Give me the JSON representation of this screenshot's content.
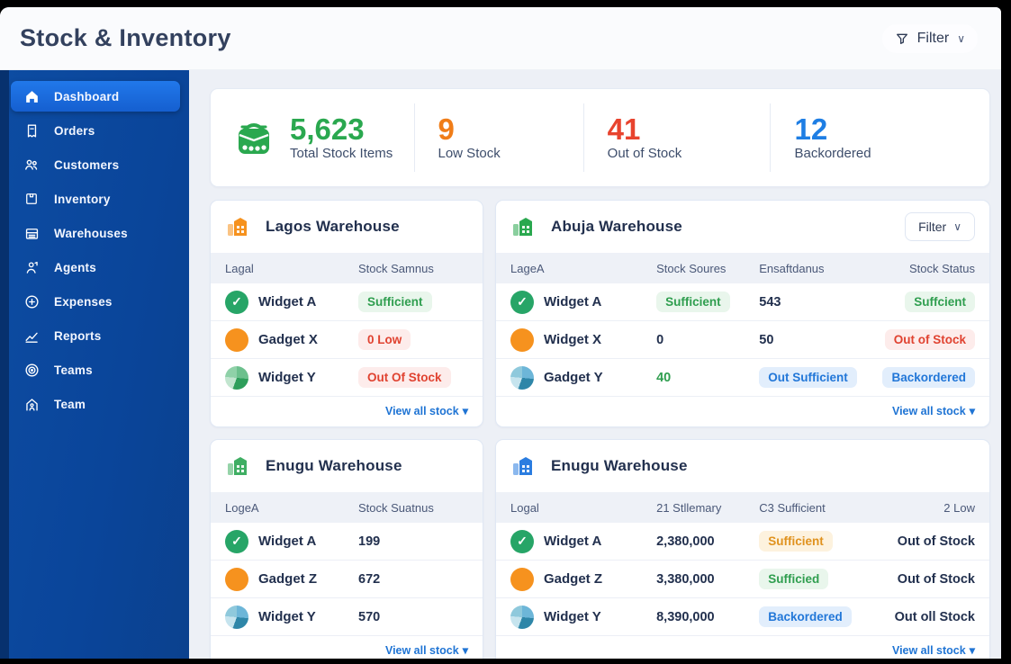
{
  "app": {
    "title": "Stock & Inventory"
  },
  "header": {
    "filter_label": "Filter"
  },
  "colors": {
    "sidebar": "#0a459a",
    "sidebar_active": "#1c6fe0",
    "green": "#2aa84f",
    "orange": "#f07d18",
    "red": "#e8432e",
    "blue": "#1e7ee4",
    "link_blue": "#1f74d4"
  },
  "sidebar": {
    "items": [
      {
        "label": "Dashboard",
        "icon": "home-icon",
        "active": true
      },
      {
        "label": "Orders",
        "icon": "receipt-icon",
        "active": false
      },
      {
        "label": "Customers",
        "icon": "customers-icon",
        "active": false
      },
      {
        "label": "Inventory",
        "icon": "box-icon",
        "active": false
      },
      {
        "label": "Warehouses",
        "icon": "warehouse-icon",
        "active": false
      },
      {
        "label": "Agents",
        "icon": "agent-icon",
        "active": false
      },
      {
        "label": "Expenses",
        "icon": "plus-circle-icon",
        "active": false
      },
      {
        "label": "Reports",
        "icon": "chart-icon",
        "active": false
      },
      {
        "label": "Teams",
        "icon": "target-icon",
        "active": false
      },
      {
        "label": "Team",
        "icon": "house-person-icon",
        "active": false
      }
    ]
  },
  "stats": [
    {
      "value": "5,623",
      "label": "Total Stock Items",
      "color": "#2aa84f",
      "icon": "basket-icon"
    },
    {
      "value": "9",
      "label": "Low Stock",
      "color": "#f07d18",
      "icon": null
    },
    {
      "value": "41",
      "label": "Out of Stock",
      "color": "#e8432e",
      "icon": null
    },
    {
      "value": "12",
      "label": "Backordered",
      "color": "#1e7ee4",
      "icon": null
    }
  ],
  "cards": [
    {
      "title": "Lagos Warehouse",
      "icon": "warehouse-orange-icon",
      "icon_color": "#f6921e",
      "filter_label": null,
      "columns": [
        "Lagal",
        "Stock Samnus"
      ],
      "rows": [
        {
          "icon": "check-circle-icon",
          "name": "Widget A",
          "cells": [
            {
              "text": "Sufficient",
              "style": "badge-green"
            }
          ]
        },
        {
          "icon": "dot-orange-icon",
          "name": "Gadget X",
          "cells": [
            {
              "text": "0 Low",
              "style": "badge-red"
            }
          ]
        },
        {
          "icon": "pie-green-icon",
          "name": "Widget Y",
          "cells": [
            {
              "text": "Out Of Stock",
              "style": "badge-red"
            }
          ]
        }
      ],
      "footer": "View all stock"
    },
    {
      "title": "Abuja Warehouse",
      "icon": "warehouse-green-icon",
      "icon_color": "#2aa84f",
      "filter_label": "Filter",
      "columns": [
        "LageA",
        "Stock Soures",
        "Ensaftdanus",
        "Stock Status"
      ],
      "rows": [
        {
          "icon": "check-circle-icon",
          "name": "Widget A",
          "cells": [
            {
              "text": "Sufficient",
              "style": "badge-green"
            },
            {
              "text": "543",
              "style": "plain"
            },
            {
              "text": "Suffcient",
              "style": "badge-green"
            }
          ]
        },
        {
          "icon": "dot-orange-icon",
          "name": "Widget X",
          "cells": [
            {
              "text": "0",
              "style": "plain"
            },
            {
              "text": "50",
              "style": "plain"
            },
            {
              "text": "Out of Stock",
              "style": "badge-red"
            }
          ]
        },
        {
          "icon": "pie-teal-icon",
          "name": "Gadget Y",
          "cells": [
            {
              "text": "40",
              "style": "text-green"
            },
            {
              "text": "Out Sufficient",
              "style": "badge-blue"
            },
            {
              "text": "Backordered",
              "style": "badge-blue"
            }
          ]
        }
      ],
      "footer": "View all stock"
    },
    {
      "title": "Enugu Warehouse",
      "icon": "warehouse-green-icon",
      "icon_color": "#3fae63",
      "filter_label": null,
      "columns": [
        "LogeA",
        "Stock Suatnus"
      ],
      "rows": [
        {
          "icon": "check-circle-icon",
          "name": "Widget A",
          "cells": [
            {
              "text": "199",
              "style": "plain"
            }
          ]
        },
        {
          "icon": "dot-orange-icon",
          "name": "Gadget Z",
          "cells": [
            {
              "text": "672",
              "style": "plain"
            }
          ]
        },
        {
          "icon": "pie-teal-icon",
          "name": "Widget Y",
          "cells": [
            {
              "text": "570",
              "style": "plain"
            }
          ]
        }
      ],
      "footer": "View all stock"
    },
    {
      "title": "Enugu Warehouse",
      "icon": "warehouse-blue-icon",
      "icon_color": "#2b7de0",
      "filter_label": null,
      "columns": [
        "Logal",
        "21 Stllemary",
        "C3 Sufficient",
        "2 Low"
      ],
      "rows": [
        {
          "icon": "check-circle-icon",
          "name": "Widget A",
          "cells": [
            {
              "text": "2,380,000",
              "style": "plain"
            },
            {
              "text": "Sufficient",
              "style": "badge-orange"
            },
            {
              "text": "Out of Stock",
              "style": "plain"
            }
          ]
        },
        {
          "icon": "dot-orange-icon",
          "name": "Gadget Z",
          "cells": [
            {
              "text": "3,380,000",
              "style": "plain"
            },
            {
              "text": "Sufficied",
              "style": "badge-green"
            },
            {
              "text": "Out of Stock",
              "style": "plain"
            }
          ]
        },
        {
          "icon": "pie-teal-icon",
          "name": "Widget Y",
          "cells": [
            {
              "text": "8,390,000",
              "style": "plain"
            },
            {
              "text": "Backordered",
              "style": "badge-blue"
            },
            {
              "text": "Out oll Stock",
              "style": "plain"
            }
          ]
        }
      ],
      "footer": "View all stock"
    }
  ]
}
